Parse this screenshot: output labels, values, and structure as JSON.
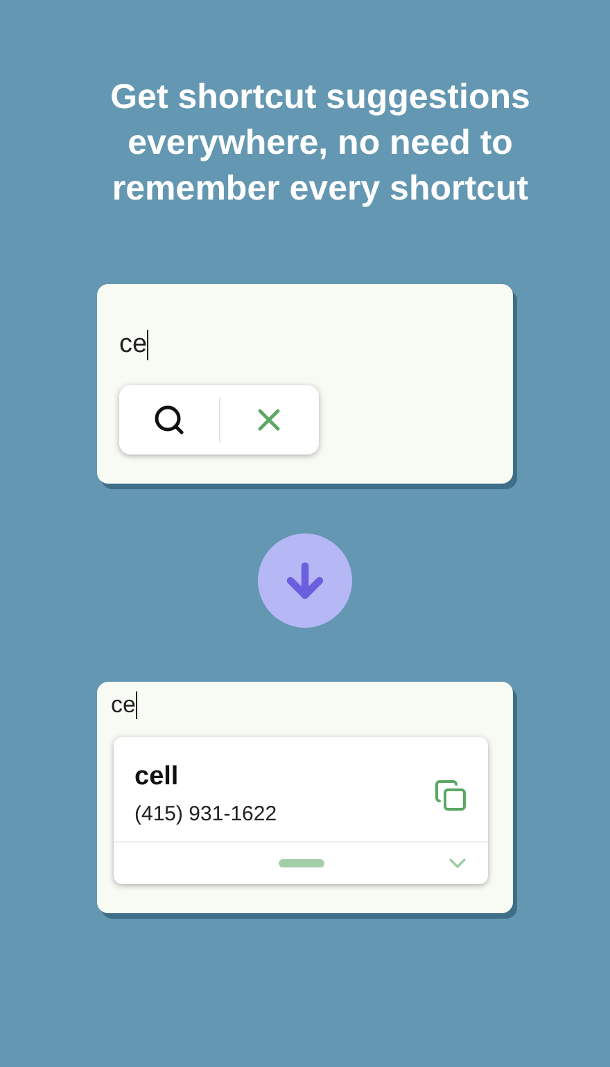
{
  "headline": "Get shortcut suggestions everywhere, no need to remember every shortcut",
  "before": {
    "field": {
      "value": "ce"
    }
  },
  "after": {
    "field": {
      "value": "ce"
    },
    "suggestion": {
      "name": "cell",
      "value": "(415) 931-1622",
      "expanded": false
    }
  }
}
